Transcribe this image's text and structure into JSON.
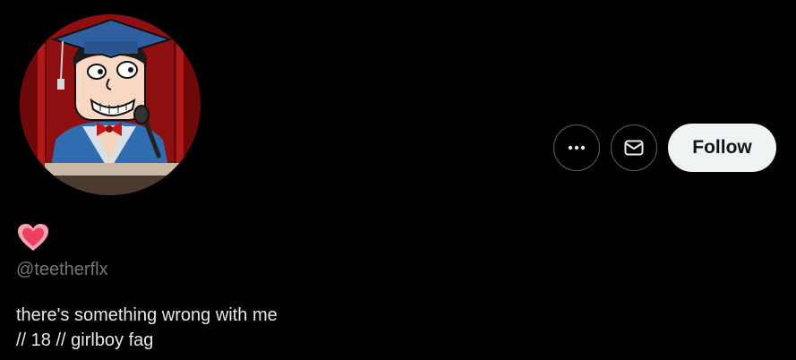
{
  "profile": {
    "display_name_emoji": "heart-emoji",
    "handle": "@teetherflx",
    "bio_lines": [
      "there's something wrong with me",
      "// 18 // girlboy fag"
    ]
  },
  "actions": {
    "more_icon": "more-horizontal-icon",
    "message_icon": "envelope-icon",
    "follow_label": "Follow"
  },
  "colors": {
    "background": "#000000",
    "text_primary": "#e7e9ea",
    "text_secondary": "#71767b",
    "border": "#536471",
    "follow_bg": "#eff3f4",
    "heart": "#f0506e"
  }
}
